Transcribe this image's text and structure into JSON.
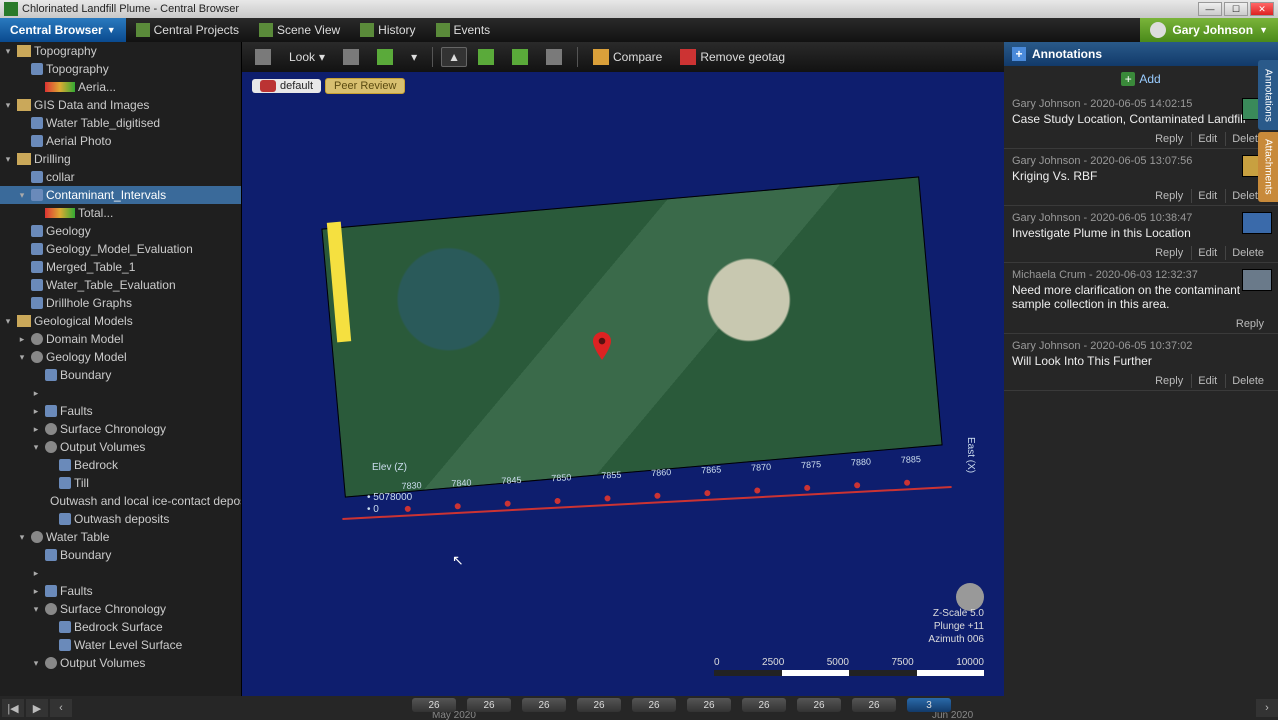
{
  "app": {
    "title": "Chlorinated Landfill Plume - Central Browser",
    "central_browser_label": "Central Browser"
  },
  "menubar": {
    "items": [
      "Central Projects",
      "Scene View",
      "History",
      "Events"
    ],
    "user": "Gary Johnson"
  },
  "toolbar": {
    "look_label": "Look",
    "compare_label": "Compare",
    "remove_geotag_label": "Remove geotag"
  },
  "pills": {
    "default": "default",
    "peer_review": "Peer Review"
  },
  "tree": [
    {
      "level": 0,
      "exp": "▾",
      "icon": "fold",
      "label": "Topography"
    },
    {
      "level": 1,
      "exp": "",
      "icon": "leaf",
      "label": "Topography"
    },
    {
      "level": 2,
      "exp": "",
      "icon": "swatch",
      "label": "Aeria...",
      "swatch": "#caa85a"
    },
    {
      "level": 0,
      "exp": "▾",
      "icon": "fold",
      "label": "GIS Data and Images"
    },
    {
      "level": 1,
      "exp": "",
      "icon": "leaf",
      "label": "Water Table_digitised"
    },
    {
      "level": 1,
      "exp": "",
      "icon": "leaf",
      "label": "Aerial Photo"
    },
    {
      "level": 0,
      "exp": "▾",
      "icon": "fold",
      "label": "Drilling"
    },
    {
      "level": 1,
      "exp": "",
      "icon": "leaf",
      "label": "collar"
    },
    {
      "level": 1,
      "exp": "▾",
      "icon": "leaf",
      "label": "Contaminant_Intervals",
      "sel": true
    },
    {
      "level": 2,
      "exp": "",
      "icon": "swatch",
      "label": "Total...",
      "swatch": "#888"
    },
    {
      "level": 1,
      "exp": "",
      "icon": "leaf",
      "label": "Geology"
    },
    {
      "level": 1,
      "exp": "",
      "icon": "leaf",
      "label": "Geology_Model_Evaluation"
    },
    {
      "level": 1,
      "exp": "",
      "icon": "leaf",
      "label": "Merged_Table_1"
    },
    {
      "level": 1,
      "exp": "",
      "icon": "leaf",
      "label": "Water_Table_Evaluation"
    },
    {
      "level": 1,
      "exp": "",
      "icon": "leaf",
      "label": "Drillhole Graphs"
    },
    {
      "level": 0,
      "exp": "▾",
      "icon": "fold",
      "label": "Geological Models"
    },
    {
      "level": 1,
      "exp": "▸",
      "icon": "gear",
      "label": "Domain Model"
    },
    {
      "level": 1,
      "exp": "▾",
      "icon": "gear",
      "label": "Geology Model"
    },
    {
      "level": 2,
      "exp": "",
      "icon": "leaf",
      "label": "Boundary"
    },
    {
      "level": 2,
      "exp": "▸",
      "icon": "",
      "label": ""
    },
    {
      "level": 2,
      "exp": "▸",
      "icon": "leaf",
      "label": "Faults"
    },
    {
      "level": 2,
      "exp": "▸",
      "icon": "gear",
      "label": "Surface Chronology"
    },
    {
      "level": 2,
      "exp": "▾",
      "icon": "gear",
      "label": "Output Volumes"
    },
    {
      "level": 3,
      "exp": "",
      "icon": "leaf",
      "label": "Bedrock"
    },
    {
      "level": 3,
      "exp": "",
      "icon": "leaf",
      "label": "Till"
    },
    {
      "level": 3,
      "exp": "",
      "icon": "leaf",
      "label": "Outwash and local ice-contact deposits"
    },
    {
      "level": 3,
      "exp": "",
      "icon": "leaf",
      "label": "Outwash deposits"
    },
    {
      "level": 1,
      "exp": "▾",
      "icon": "gear",
      "label": "Water Table"
    },
    {
      "level": 2,
      "exp": "",
      "icon": "leaf",
      "label": "Boundary"
    },
    {
      "level": 2,
      "exp": "▸",
      "icon": "",
      "label": ""
    },
    {
      "level": 2,
      "exp": "▸",
      "icon": "leaf",
      "label": "Faults"
    },
    {
      "level": 2,
      "exp": "▾",
      "icon": "gear",
      "label": "Surface Chronology"
    },
    {
      "level": 3,
      "exp": "",
      "icon": "leaf",
      "label": "Bedrock Surface"
    },
    {
      "level": 3,
      "exp": "",
      "icon": "leaf",
      "label": "Water Level Surface"
    },
    {
      "level": 2,
      "exp": "▾",
      "icon": "gear",
      "label": "Output Volumes"
    }
  ],
  "viewport": {
    "elev_label": "Elev (Z)",
    "northing": "5078000",
    "zero": "0",
    "east_label": "East (X)",
    "ticks": [
      "7830",
      "7840",
      "7845",
      "7850",
      "7855",
      "7860",
      "7865",
      "7870",
      "7875",
      "7880",
      "7885"
    ],
    "hud": {
      "zscale": "Z-Scale 5.0",
      "plunge": "Plunge +11",
      "azimuth": "Azimuth 006"
    },
    "scale_labels": [
      "0",
      "2500",
      "5000",
      "7500",
      "10000"
    ]
  },
  "annotations": {
    "panel_title": "Annotations",
    "add_label": "Add",
    "actions": {
      "reply": "Reply",
      "edit": "Edit",
      "delete": "Delete"
    },
    "items": [
      {
        "meta": "Gary Johnson - 2020-06-05 14:02:15",
        "title": "Case Study Location, Contaminated Landfill",
        "thumb": "#3a8a5a",
        "editable": true
      },
      {
        "meta": "Gary Johnson - 2020-06-05 13:07:56",
        "title": "Kriging Vs. RBF",
        "thumb": "#c8a040",
        "editable": true
      },
      {
        "meta": "Gary Johnson - 2020-06-05 10:38:47",
        "title": "Investigate Plume in this Location",
        "thumb": "#3a6aaa",
        "editable": true
      },
      {
        "meta": "Michaela Crum - 2020-06-03 12:32:37",
        "title": "Need more clarification on the contaminant sample collection in this area.",
        "thumb": "#6a7a8a",
        "editable": false
      },
      {
        "meta": "Gary Johnson - 2020-06-05 10:37:02",
        "title": "Will Look Into This Further",
        "thumb": "",
        "editable": true
      }
    ],
    "side_tabs": [
      "Annotations",
      "Attachments"
    ]
  },
  "timeline": {
    "segments": [
      "26",
      "26",
      "26",
      "26",
      "26",
      "26",
      "26",
      "26",
      "26",
      "3"
    ],
    "month_left": "May 2020",
    "month_right": "Jun 2020"
  }
}
